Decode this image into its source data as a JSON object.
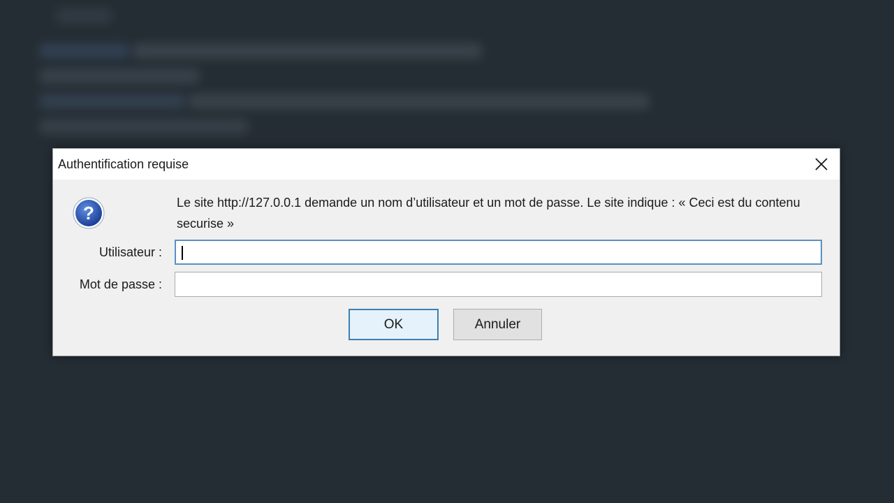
{
  "dialog": {
    "title": "Authentification requise",
    "close_icon": "close-icon",
    "question_icon": "question-icon",
    "message": "Le site http://127.0.0.1 demande un nom d’utilisateur et un mot de passe. Le site indique : « Ceci est du contenu securise »",
    "user_label": "Utilisateur :",
    "user_value": "",
    "password_label": "Mot de passe :",
    "password_value": "",
    "ok_label": "OK",
    "cancel_label": "Annuler"
  },
  "colors": {
    "backdrop": "#252d34",
    "dialog_bg": "#f0f0f0",
    "focus_border": "#5b8fc4",
    "icon_blue": "#1f4ea8"
  }
}
